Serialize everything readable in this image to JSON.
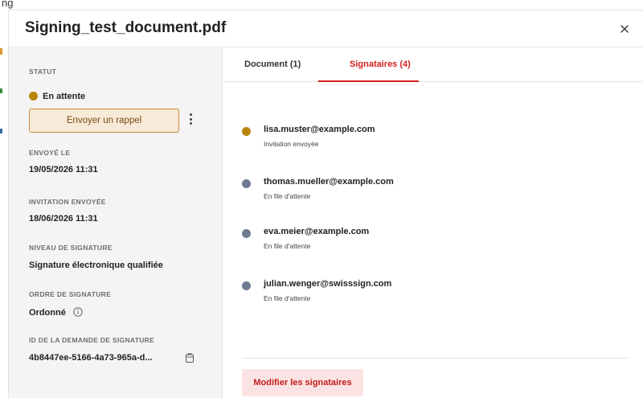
{
  "backdrop": {
    "text": "ng"
  },
  "modal": {
    "title": "Signing_test_document.pdf"
  },
  "sidebar": {
    "status_label": "STATUT",
    "status_value": "En attente",
    "status_color": "#b8860b",
    "reminder_button": "Envoyer un rappel",
    "sent_label": "ENVOYÉ LE",
    "sent_value": "19/05/2026 11:31",
    "invitation_label": "INVITATION ENVOYÉE",
    "invitation_value": "18/06/2026 11:31",
    "level_label": "NIVEAU DE SIGNATURE",
    "level_value": "Signature électronique qualifiée",
    "order_label": "ORDRE DE SIGNATURE",
    "order_value": "Ordonné",
    "request_id_label": "ID DE LA DEMANDE DE SIGNATURE",
    "request_id_value": "4b8447ee-5166-4a73-965a-d..."
  },
  "tabs": [
    {
      "label": "Document (1)",
      "active": false
    },
    {
      "label": "Signataires (4)",
      "active": true
    }
  ],
  "signers": [
    {
      "email": "lisa.muster@example.com",
      "status": "Invitation envoyée",
      "dot_color": "#b8860b"
    },
    {
      "email": "thomas.mueller@example.com",
      "status": "En file d'attente",
      "dot_color": "#6e7b90"
    },
    {
      "email": "eva.meier@example.com",
      "status": "En file d'attente",
      "dot_color": "#6e7b90"
    },
    {
      "email": "julian.wenger@swisssign.com",
      "status": "En file d'attente",
      "dot_color": "#6e7b90"
    }
  ],
  "actions": {
    "modify_signers": "Modifier les signataires"
  },
  "colors": {
    "accent": "#d42020",
    "pending": "#b8860b",
    "queued": "#6e7b90"
  }
}
